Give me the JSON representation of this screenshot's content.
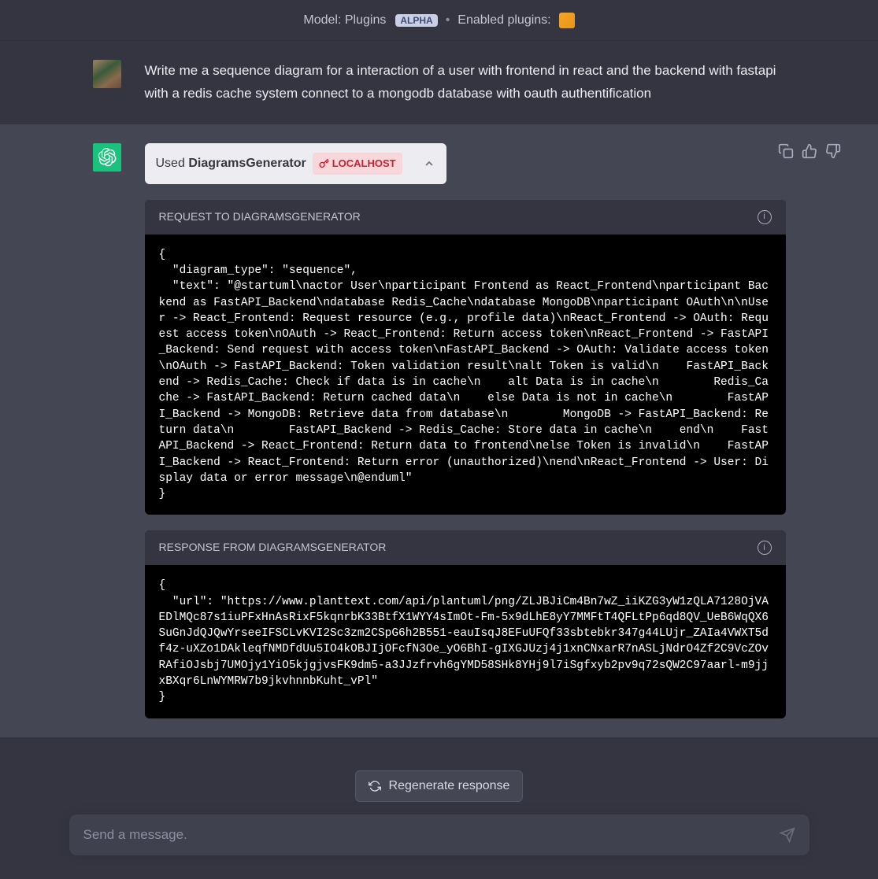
{
  "topbar": {
    "model_prefix": "Model:",
    "model_name": "Plugins",
    "alpha_badge": "ALPHA",
    "enabled_label": "Enabled plugins:"
  },
  "user_message": {
    "text": "Write me a sequence diagram for a interaction of a user with frontend in react and the backend with fastapi with a redis cache system connect to a mongodb database with oauth authentification"
  },
  "assistant_message": {
    "plugin_used_prefix": "Used",
    "plugin_name": "DiagramsGenerator",
    "localhost_label": "LOCALHOST",
    "request_header": "REQUEST TO DIAGRAMSGENERATOR",
    "request_body": "{\n  \"diagram_type\": \"sequence\",\n  \"text\": \"@startuml\\nactor User\\nparticipant Frontend as React_Frontend\\nparticipant Backend as FastAPI_Backend\\ndatabase Redis_Cache\\ndatabase MongoDB\\nparticipant OAuth\\n\\nUser -> React_Frontend: Request resource (e.g., profile data)\\nReact_Frontend -> OAuth: Request access token\\nOAuth -> React_Frontend: Return access token\\nReact_Frontend -> FastAPI_Backend: Send request with access token\\nFastAPI_Backend -> OAuth: Validate access token\\nOAuth -> FastAPI_Backend: Token validation result\\nalt Token is valid\\n    FastAPI_Backend -> Redis_Cache: Check if data is in cache\\n    alt Data is in cache\\n        Redis_Cache -> FastAPI_Backend: Return cached data\\n    else Data is not in cache\\n        FastAPI_Backend -> MongoDB: Retrieve data from database\\n        MongoDB -> FastAPI_Backend: Return data\\n        FastAPI_Backend -> Redis_Cache: Store data in cache\\n    end\\n    FastAPI_Backend -> React_Frontend: Return data to frontend\\nelse Token is invalid\\n    FastAPI_Backend -> React_Frontend: Return error (unauthorized)\\nend\\nReact_Frontend -> User: Display data or error message\\n@enduml\"\n}",
    "response_header": "RESPONSE FROM DIAGRAMSGENERATOR",
    "response_body": "{\n  \"url\": \"https://www.planttext.com/api/plantuml/png/ZLJBJiCm4Bn7wZ_iiKZG3yW1zQLA7128OjVAEDlMQc87s1iuPFxHnAsRixF5kqnrbK33BtfX1WYY4sImOt-Fm-5x9dLhE8yY7MMFtT4QFLtPp6qd8QV_UeB6WqQX6SuGnJdQJQwYrseeIFSCLvKVI2Sc3zm2CSpG6h2B551-eauIsqJ8EFuUFQf33sbtebkr347g44LUjr_ZAIa4VWXT5df4z-uXZo1DAkleqfNMDfdUu5IO4kOBJIjOFcfN3Oe_yO6BhI-gIXGJUzj4j1xnCNxarR7nASLjNdrO4Zf2C9VcZOvRAfiOJsbj7UMOjy1YiO5kjgjvsFK9dm5-a3JJzfrvh6gYMD58SHk8YHj9l7iSgfxyb2pv9q72sQW2C97aarl-m9jjxBXqr6LnWYMRW7b9jkvhnnbKuht_vPl\"\n}"
  },
  "regenerate": {
    "label": "Regenerate response"
  },
  "input": {
    "placeholder": "Send a message."
  }
}
